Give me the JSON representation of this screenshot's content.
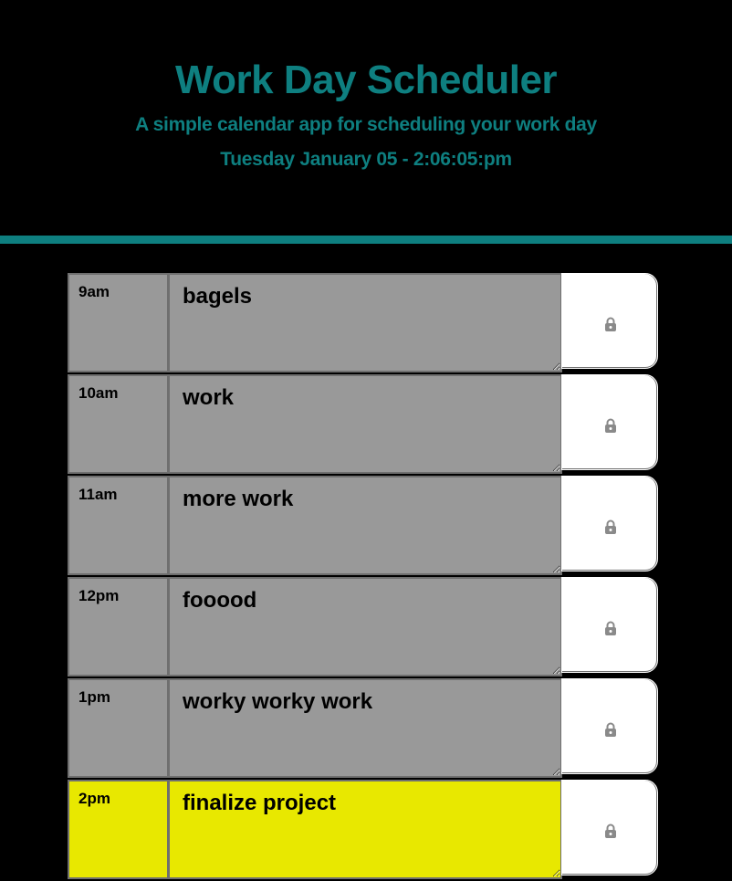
{
  "header": {
    "title": "Work Day Scheduler",
    "subtitle": "A simple calendar app for scheduling your work day",
    "current_day": "Tuesday January 05 - 2:06:05:pm"
  },
  "colors": {
    "accent": "#0e7f80",
    "past": "#999999",
    "present": "#e8e800",
    "background": "#000000"
  },
  "rows": [
    {
      "hour": "9am",
      "task": "bagels",
      "state": "past",
      "icon": "lock-icon"
    },
    {
      "hour": "10am",
      "task": "work",
      "state": "past",
      "icon": "lock-icon"
    },
    {
      "hour": "11am",
      "task": "more work",
      "state": "past",
      "icon": "lock-icon"
    },
    {
      "hour": "12pm",
      "task": "fooood",
      "state": "past",
      "icon": "lock-icon"
    },
    {
      "hour": "1pm",
      "task": "worky worky work",
      "state": "past",
      "icon": "lock-icon"
    },
    {
      "hour": "2pm",
      "task": "finalize project",
      "state": "present",
      "icon": "lock-icon"
    }
  ]
}
